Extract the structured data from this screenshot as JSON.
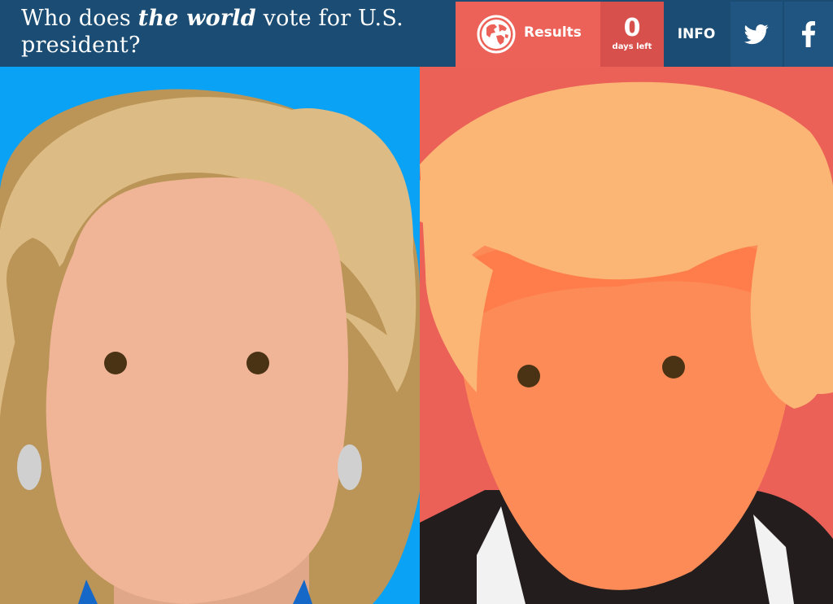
{
  "header": {
    "title_pre": "Who does ",
    "title_em": "the world",
    "title_post": " vote for U.S. president?"
  },
  "nav": {
    "results_label": "Results",
    "days_count": "0",
    "days_label": "days left",
    "info_label": "INFO"
  },
  "colors": {
    "header_bg": "#1b4c73",
    "results_bg": "#ec6258",
    "days_bg": "#d8504b",
    "left_panel_bg": "#09a2f5",
    "right_panel_bg": "#eb6158",
    "left_hair": "#ddbb84",
    "left_skin": "#f0b597",
    "right_hair": "#fbb574",
    "right_skin": "#fd8b58"
  },
  "icons": {
    "results": "globe-icon",
    "twitter": "twitter-icon",
    "facebook": "facebook-icon"
  }
}
